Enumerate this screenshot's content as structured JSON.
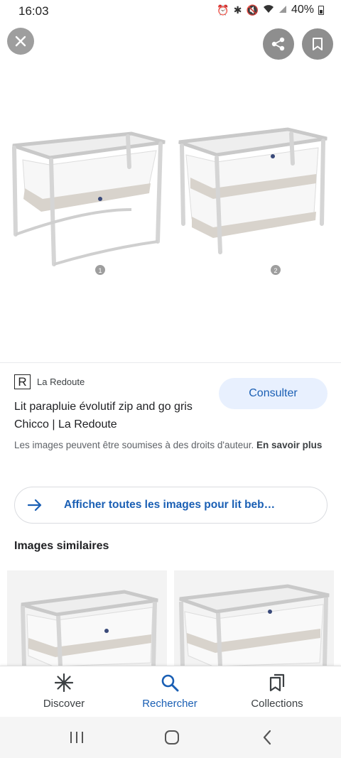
{
  "status_bar": {
    "time": "16:03",
    "battery": "40%",
    "icons": [
      "alarm-icon",
      "bluetooth-icon",
      "mute-icon",
      "wifi-icon",
      "signal-icon",
      "battery-icon"
    ]
  },
  "top_controls": {
    "close_icon": "close-icon",
    "share_icon": "share-icon",
    "save_icon": "bookmark-icon"
  },
  "image": {
    "badges": [
      "1",
      "2"
    ]
  },
  "source": {
    "logo_letter": "R",
    "name": "La Redoute"
  },
  "consult_button": "Consulter",
  "result_title": "Lit parapluie évolutif zip and go gris Chicco | La Redoute",
  "copyright": {
    "text": "Les images peuvent être soumises à des droits d'auteur.",
    "link": "En savoir plus"
  },
  "show_all_button": "Afficher toutes les images pour lit beb…",
  "similar_section_title": "Images similaires",
  "bottom_nav": {
    "items": [
      {
        "label": "Discover",
        "icon": "asterisk-icon"
      },
      {
        "label": "Rechercher",
        "icon": "search-icon",
        "active": true
      },
      {
        "label": "Collections",
        "icon": "collections-icon"
      }
    ]
  },
  "colors": {
    "accent": "#1a5fb4",
    "consult_bg": "#e8f0fe",
    "icon_button_bg": "#8e8e8e"
  }
}
